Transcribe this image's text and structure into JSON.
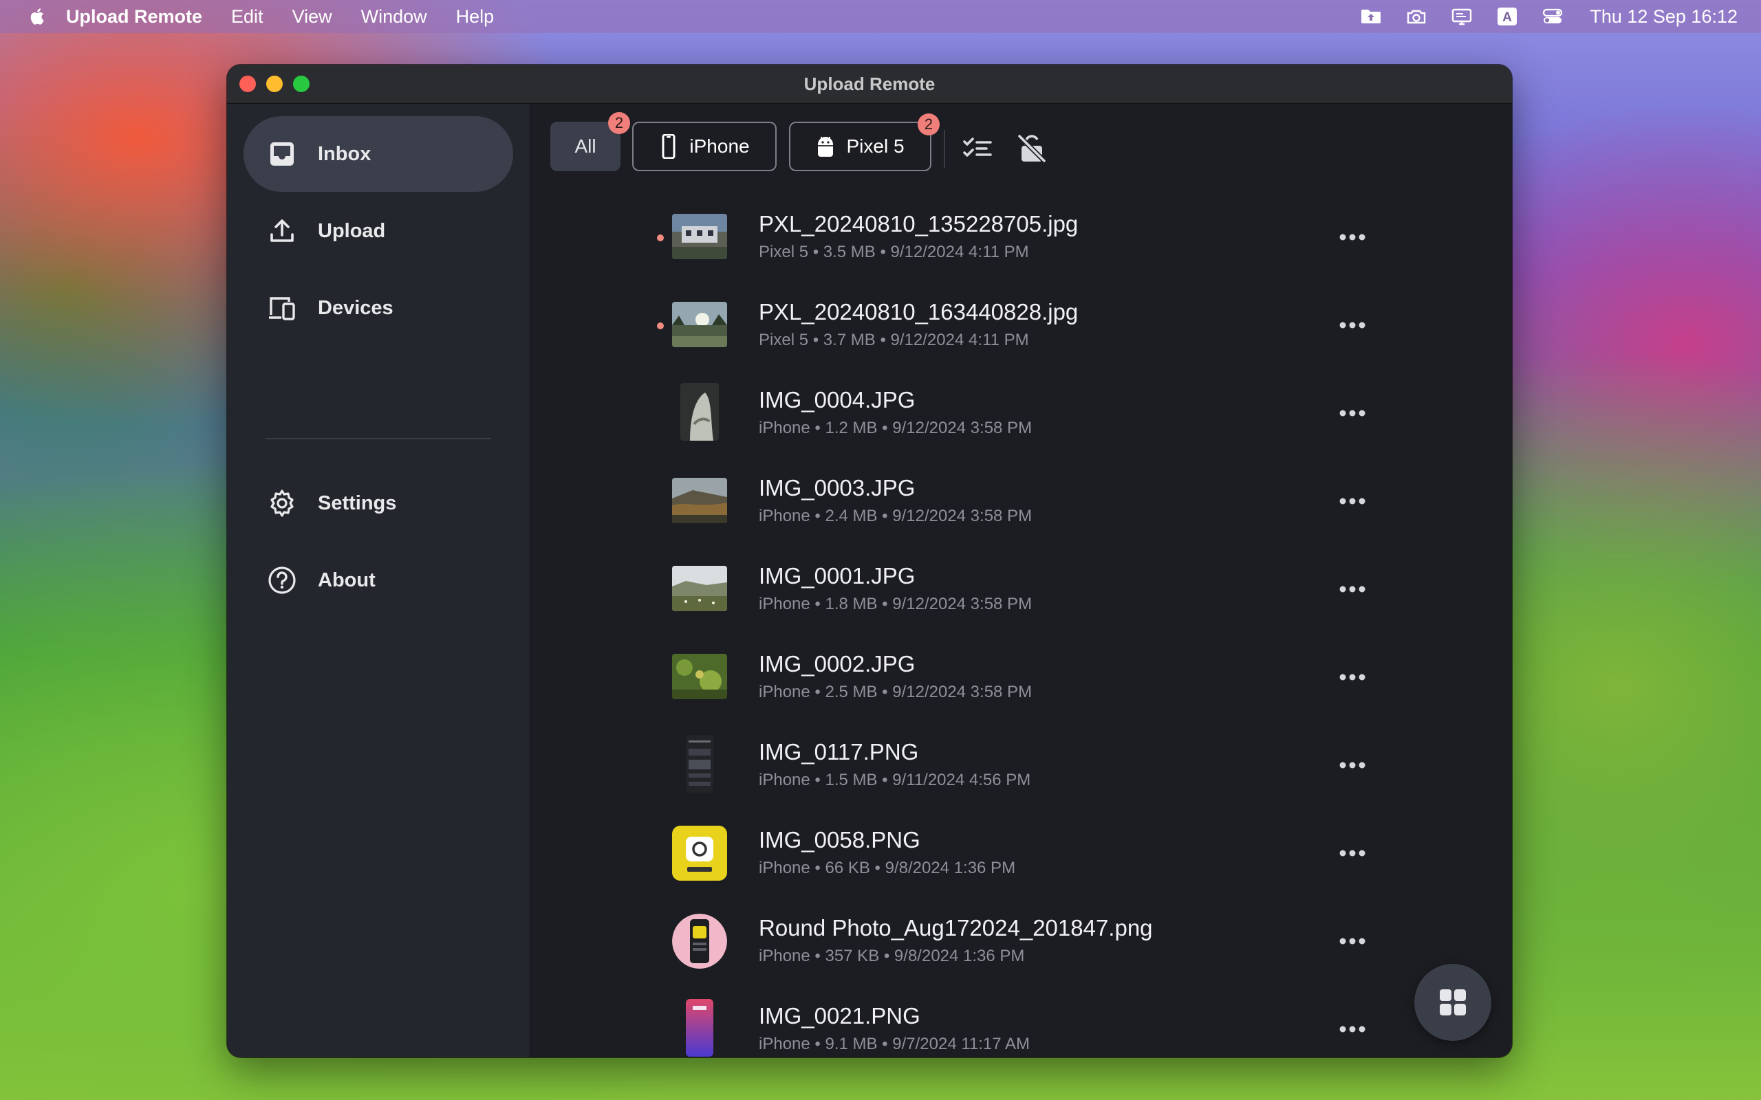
{
  "menubar": {
    "app_name": "Upload Remote",
    "menus": [
      "Edit",
      "View",
      "Window",
      "Help"
    ],
    "clock": "Thu 12 Sep  16:12",
    "status_icons": [
      "folder-upload-icon",
      "camera-icon",
      "display-icon",
      "keyboard-a-icon",
      "control-center-icon"
    ],
    "keyboard_letter": "A"
  },
  "window": {
    "title": "Upload Remote"
  },
  "sidebar": {
    "items": [
      {
        "label": "Inbox",
        "icon": "inbox-icon",
        "active": true
      },
      {
        "label": "Upload",
        "icon": "upload-icon",
        "active": false
      },
      {
        "label": "Devices",
        "icon": "devices-icon",
        "active": false
      },
      {
        "label": "Settings",
        "icon": "gear-icon",
        "active": false
      },
      {
        "label": "About",
        "icon": "help-circle-icon",
        "active": false
      }
    ]
  },
  "filters": {
    "all": {
      "label": "All",
      "badge": "2"
    },
    "iphone": {
      "label": "iPhone",
      "icon": "iphone-icon"
    },
    "pixel": {
      "label": "Pixel 5",
      "icon": "android-icon",
      "badge": "2"
    },
    "tools": [
      "checklist-icon",
      "lock-slash-icon"
    ]
  },
  "files": [
    {
      "name": "PXL_20240810_135228705.jpg",
      "meta": "Pixel 5 • 3.5 MB • 9/12/2024 4:11 PM",
      "new": true,
      "thumb": "landscape-icon"
    },
    {
      "name": "PXL_20240810_163440828.jpg",
      "meta": "Pixel 5 • 3.7 MB • 9/12/2024 4:11 PM",
      "new": true,
      "thumb": "landscape-icon"
    },
    {
      "name": "IMG_0004.JPG",
      "meta": "iPhone • 1.2 MB • 9/12/2024 3:58 PM",
      "new": false,
      "thumb": "portrait-photo-icon"
    },
    {
      "name": "IMG_0003.JPG",
      "meta": "iPhone • 2.4 MB • 9/12/2024 3:58 PM",
      "new": false,
      "thumb": "landscape-icon"
    },
    {
      "name": "IMG_0001.JPG",
      "meta": "iPhone • 1.8 MB • 9/12/2024 3:58 PM",
      "new": false,
      "thumb": "landscape-icon"
    },
    {
      "name": "IMG_0002.JPG",
      "meta": "iPhone • 2.5 MB • 9/12/2024 3:58 PM",
      "new": false,
      "thumb": "landscape-icon"
    },
    {
      "name": "IMG_0117.PNG",
      "meta": "iPhone • 1.5 MB • 9/11/2024 4:56 PM",
      "new": false,
      "thumb": "screenshot-icon"
    },
    {
      "name": "IMG_0058.PNG",
      "meta": "iPhone • 66 KB • 9/8/2024 1:36 PM",
      "new": false,
      "thumb": "app-icon"
    },
    {
      "name": "Round Photo_Aug172024_201847.png",
      "meta": "iPhone • 357 KB • 9/8/2024 1:36 PM",
      "new": false,
      "thumb": "round-photo-icon"
    },
    {
      "name": "IMG_0021.PNG",
      "meta": "iPhone • 9.1 MB • 9/7/2024 11:17 AM",
      "new": false,
      "thumb": "screenshot-icon"
    }
  ],
  "fab": {
    "icon": "grid-icon"
  },
  "colors": {
    "window_bg": "#1c1d22",
    "sidebar_bg": "#24262d",
    "active_item": "#3a3f4b",
    "badge": "#f07e7a",
    "new_dot": "#f28b80"
  }
}
